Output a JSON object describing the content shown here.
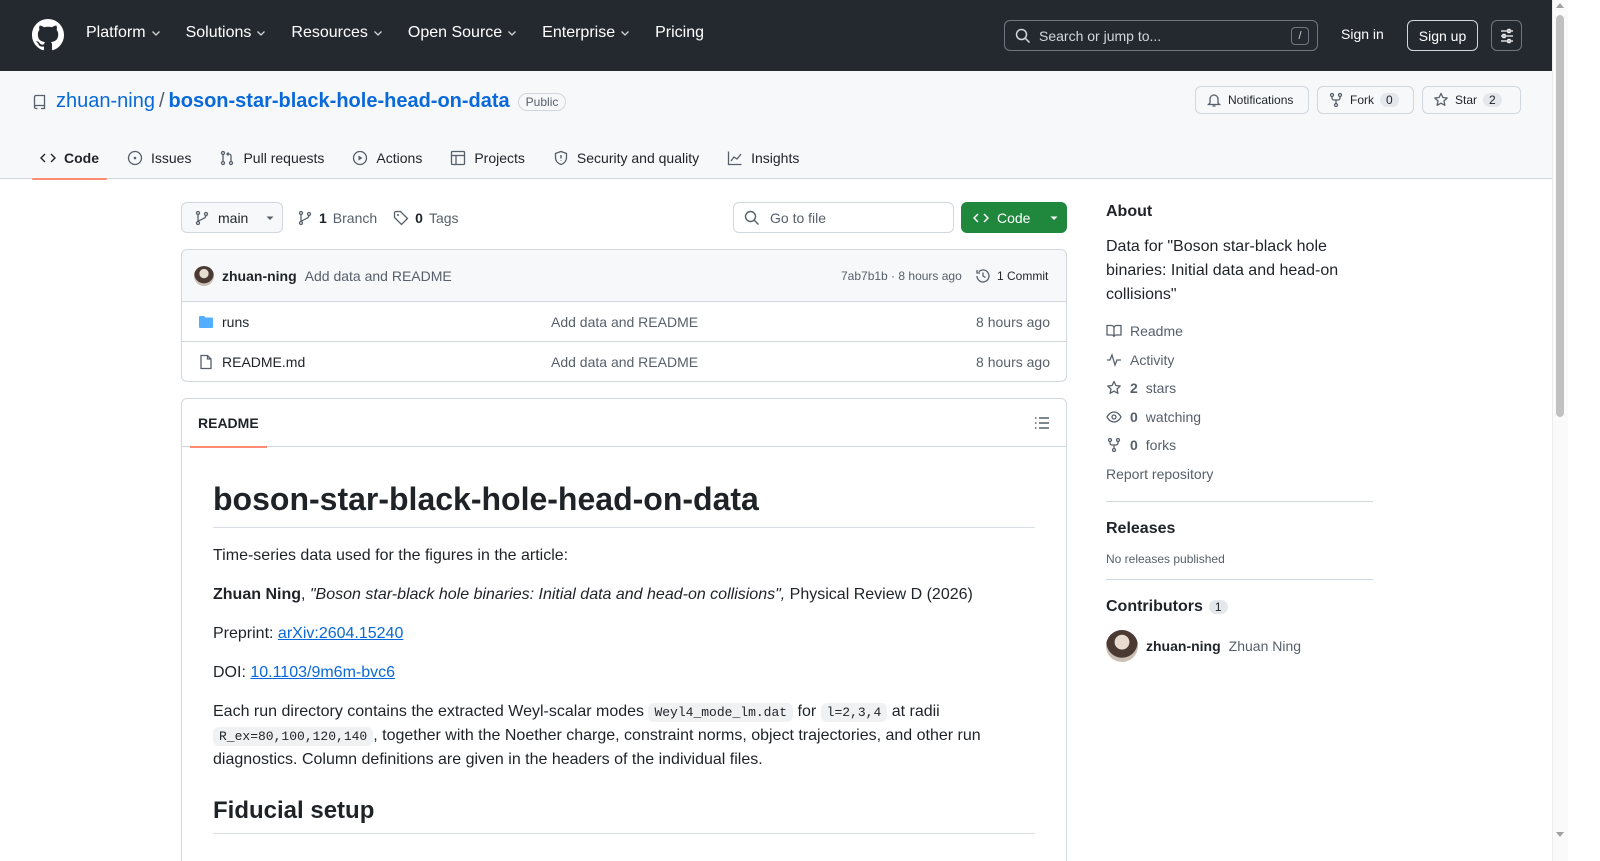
{
  "header": {
    "nav": [
      {
        "label": "Platform"
      },
      {
        "label": "Solutions"
      },
      {
        "label": "Resources"
      },
      {
        "label": "Open Source"
      },
      {
        "label": "Enterprise"
      },
      {
        "label": "Pricing"
      }
    ],
    "search_placeholder": "Search or jump to...",
    "search_shortcut": "/",
    "sign_in": "Sign in",
    "sign_up": "Sign up"
  },
  "repo": {
    "owner": "zhuan-ning",
    "separator": "/",
    "name": "boson-star-black-hole-head-on-data",
    "visibility": "Public",
    "notifications_label": "Notifications",
    "fork_label": "Fork",
    "fork_count": "0",
    "star_label": "Star",
    "star_count": "2"
  },
  "tabs": [
    {
      "label": "Code"
    },
    {
      "label": "Issues"
    },
    {
      "label": "Pull requests"
    },
    {
      "label": "Actions"
    },
    {
      "label": "Projects"
    },
    {
      "label": "Security and quality"
    },
    {
      "label": "Insights"
    }
  ],
  "toolbar": {
    "branch": "main",
    "branch_count": "1",
    "branch_word": "Branch",
    "tag_count": "0",
    "tag_word": "Tags",
    "goto_placeholder": "Go to file",
    "code_label": "Code"
  },
  "commit": {
    "author": "zhuan-ning",
    "message": "Add data and README",
    "meta": "7ab7b1b · 8 hours ago",
    "count": "1 Commit"
  },
  "files": [
    {
      "name": "runs",
      "message": "Add data and README",
      "date": "8 hours ago"
    },
    {
      "name": "README.md",
      "message": "Add data and README",
      "date": "8 hours ago"
    }
  ],
  "readme": {
    "tab": "README",
    "h1": "boson-star-black-hole-head-on-data",
    "intro": "Time-series data used for the figures in the article:",
    "cite_author": "Zhuan Ning",
    "cite_sep": ", ",
    "cite_title": "\"Boson star-black hole binaries: Initial data and head-on collisions\",",
    "cite_journal": " Physical Review D (2026)",
    "preprint_label": "Preprint: ",
    "preprint_link": "arXiv:2604.15240",
    "doi_label": "DOI: ",
    "doi_link": "10.1103/9m6m-bvc6",
    "p_run_a": "Each run directory contains the extracted Weyl-scalar modes ",
    "code_file": "Weyl4_mode_lm.dat",
    "p_run_b": " for ",
    "code_l": "l=2,3,4",
    "p_run_c": " at radii ",
    "code_r": "R_ex=80,100,120,140",
    "p_run_d": ", together with the Noether charge, constraint norms, object trajectories, and other run diagnostics. Column definitions are given in the headers of the individual files.",
    "h2": "Fiducial setup"
  },
  "sidebar": {
    "about_title": "About",
    "about_text": "Data for \"Boson star-black hole binaries: Initial data and head-on collisions\"",
    "readme": "Readme",
    "activity": "Activity",
    "stars_count": "2",
    "stars_word": "stars",
    "watching_count": "0",
    "watching_word": "watching",
    "forks_count": "0",
    "forks_word": "forks",
    "report": "Report repository",
    "releases_title": "Releases",
    "releases_text": "No releases published",
    "contributors_title": "Contributors",
    "contributors_count": "1",
    "contributor_login": "zhuan-ning",
    "contributor_name": "Zhuan Ning"
  }
}
